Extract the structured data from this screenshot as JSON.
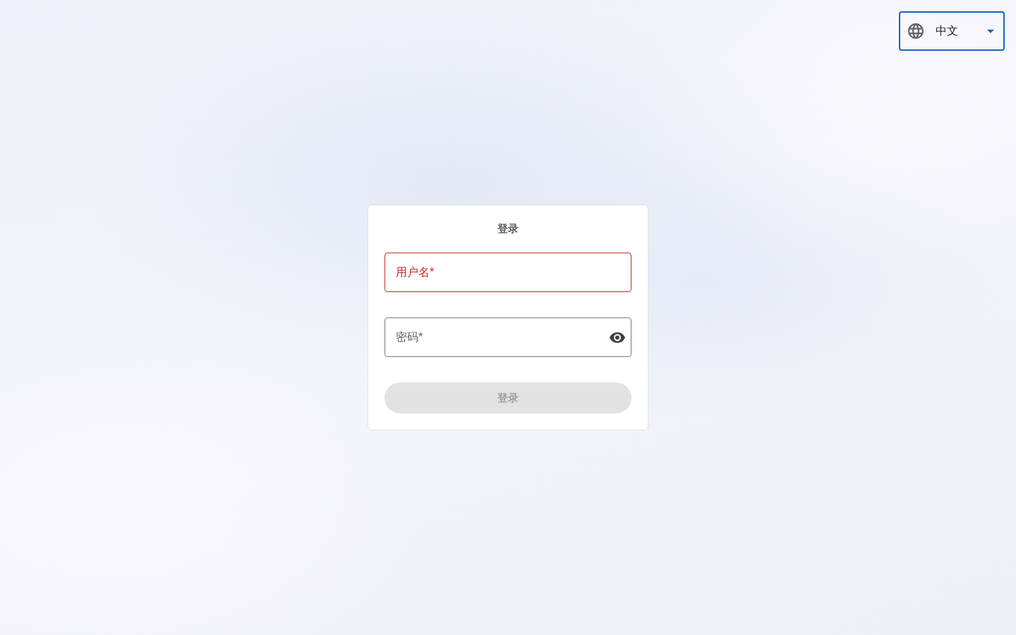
{
  "language_select": {
    "value": "中文",
    "focused": true
  },
  "login_card": {
    "title": "登录",
    "fields": [
      {
        "kind": "text",
        "placeholder": "用户名*",
        "error": true
      },
      {
        "kind": "password",
        "placeholder": "密码*",
        "error": false
      }
    ],
    "submit": {
      "label": "登录",
      "disabled": true
    }
  }
}
